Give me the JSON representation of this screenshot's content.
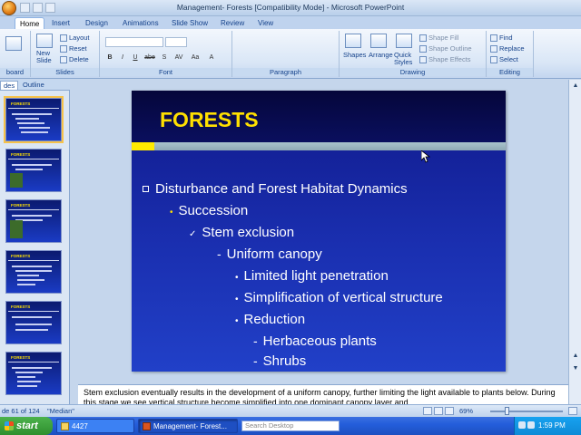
{
  "window": {
    "title": "Management- Forests [Compatibility Mode] - Microsoft PowerPoint"
  },
  "tabs": [
    "Home",
    "Insert",
    "Design",
    "Animations",
    "Slide Show",
    "Review",
    "View"
  ],
  "ribbon": {
    "clipboard_label": "board",
    "slides": {
      "new_slide_line1": "New",
      "new_slide_line2": "Slide",
      "layout": "Layout",
      "reset": "Reset",
      "delete": "Delete",
      "label": "Slides"
    },
    "font_label": "Font",
    "font_buttons": [
      "B",
      "I",
      "U",
      "abe",
      "S",
      "AV",
      "Aa",
      "A"
    ],
    "paragraph_label": "Paragraph",
    "drawing": {
      "shapes": "Shapes",
      "arrange": "Arrange",
      "quick_styles_line1": "Quick",
      "quick_styles_line2": "Styles",
      "shape_fill": "Shape Fill",
      "shape_outline": "Shape Outline",
      "shape_effects": "Shape Effects",
      "label": "Drawing"
    },
    "editing": {
      "find": "Find",
      "replace": "Replace",
      "select": "Select",
      "label": "Editing"
    }
  },
  "left_pane": {
    "tab_slides": "des",
    "tab_outline": "Outline",
    "thumbnail_title": "FORESTS"
  },
  "slide": {
    "title": "FORESTS",
    "bullets": [
      {
        "level": 1,
        "marker": "box",
        "text": "Disturbance and Forest Habitat Dynamics"
      },
      {
        "level": 2,
        "marker": "•",
        "text": "Succession"
      },
      {
        "level": 3,
        "marker": "✓",
        "text": "Stem exclusion"
      },
      {
        "level": 4,
        "marker": "-",
        "text": "Uniform canopy"
      },
      {
        "level": 5,
        "marker": "•",
        "text": "Limited light penetration"
      },
      {
        "level": 5,
        "marker": "•",
        "text": "Simplification of vertical structure"
      },
      {
        "level": 5,
        "marker": "•",
        "text": "Reduction"
      },
      {
        "level": 6,
        "marker": "-",
        "text": "Herbaceous plants"
      },
      {
        "level": 6,
        "marker": "-",
        "text": "Shrubs"
      }
    ]
  },
  "notes": {
    "text": "Stem exclusion eventually results in the development of a uniform canopy, further limiting the light available to plants below.  During this stage we see vertical structure become simplified into one dominant canopy layer and"
  },
  "status": {
    "slide_counter": "de 61 of 124",
    "theme": "\"Median\"",
    "zoom": "69%"
  },
  "taskbar": {
    "start": "start",
    "folder_button": "4427",
    "ppt_button": "Management- Forest...",
    "search_placeholder": "Search Desktop",
    "clock": "1:59 PM"
  },
  "colors": {
    "slide_title": "#ffe000",
    "slide_background": "#1a2fb0",
    "accent_bar": "#a9c3cc"
  }
}
